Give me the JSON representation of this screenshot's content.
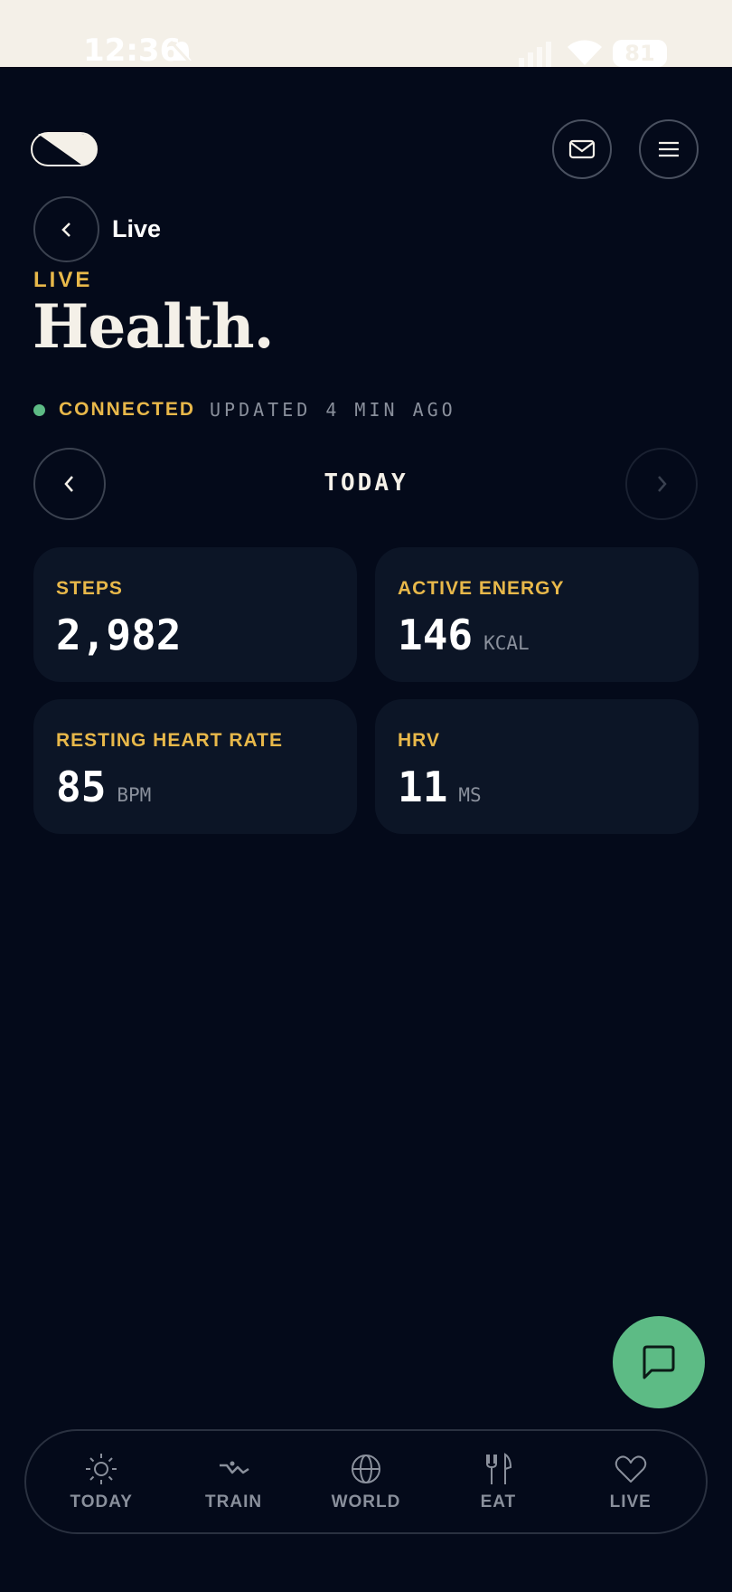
{
  "status_bar": {
    "time": "12:36",
    "battery": "81"
  },
  "header": {
    "back_label": "Live",
    "eyebrow": "LIVE",
    "title": "Health."
  },
  "connection": {
    "status": "CONNECTED",
    "updated": "UPDATED 4 MIN AGO",
    "status_color": "#5dbb85"
  },
  "date_nav": {
    "label": "TODAY"
  },
  "metrics": [
    {
      "label": "STEPS",
      "value": "2,982",
      "unit": ""
    },
    {
      "label": "ACTIVE ENERGY",
      "value": "146",
      "unit": "KCAL"
    },
    {
      "label": "RESTING HEART RATE",
      "value": "85",
      "unit": "BPM"
    },
    {
      "label": "HRV",
      "value": "11",
      "unit": "MS"
    }
  ],
  "bottom_nav": [
    {
      "label": "TODAY",
      "icon": "sun-icon"
    },
    {
      "label": "TRAIN",
      "icon": "run-icon"
    },
    {
      "label": "WORLD",
      "icon": "globe-icon"
    },
    {
      "label": "EAT",
      "icon": "utensils-icon"
    },
    {
      "label": "LIVE",
      "icon": "heart-icon"
    }
  ],
  "colors": {
    "background": "#040a1a",
    "card": "#0c1526",
    "accent": "#e8b84a",
    "green": "#5dbb85",
    "text": "#f4f0e8",
    "muted": "#8a909c"
  }
}
